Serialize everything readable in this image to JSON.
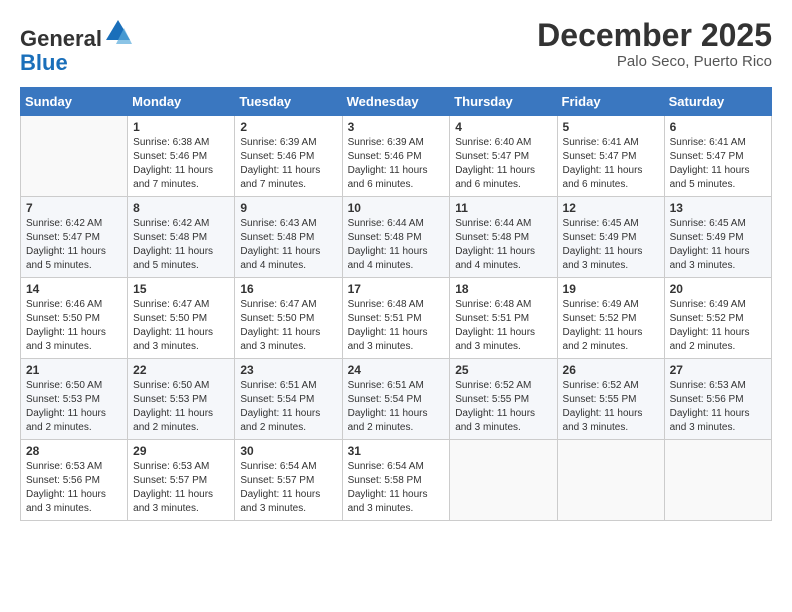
{
  "logo": {
    "general": "General",
    "blue": "Blue"
  },
  "title": "December 2025",
  "location": "Palo Seco, Puerto Rico",
  "days_of_week": [
    "Sunday",
    "Monday",
    "Tuesday",
    "Wednesday",
    "Thursday",
    "Friday",
    "Saturday"
  ],
  "weeks": [
    [
      {
        "day": "",
        "info": ""
      },
      {
        "day": "1",
        "info": "Sunrise: 6:38 AM\nSunset: 5:46 PM\nDaylight: 11 hours and 7 minutes."
      },
      {
        "day": "2",
        "info": "Sunrise: 6:39 AM\nSunset: 5:46 PM\nDaylight: 11 hours and 7 minutes."
      },
      {
        "day": "3",
        "info": "Sunrise: 6:39 AM\nSunset: 5:46 PM\nDaylight: 11 hours and 6 minutes."
      },
      {
        "day": "4",
        "info": "Sunrise: 6:40 AM\nSunset: 5:47 PM\nDaylight: 11 hours and 6 minutes."
      },
      {
        "day": "5",
        "info": "Sunrise: 6:41 AM\nSunset: 5:47 PM\nDaylight: 11 hours and 6 minutes."
      },
      {
        "day": "6",
        "info": "Sunrise: 6:41 AM\nSunset: 5:47 PM\nDaylight: 11 hours and 5 minutes."
      }
    ],
    [
      {
        "day": "7",
        "info": "Sunrise: 6:42 AM\nSunset: 5:47 PM\nDaylight: 11 hours and 5 minutes."
      },
      {
        "day": "8",
        "info": "Sunrise: 6:42 AM\nSunset: 5:48 PM\nDaylight: 11 hours and 5 minutes."
      },
      {
        "day": "9",
        "info": "Sunrise: 6:43 AM\nSunset: 5:48 PM\nDaylight: 11 hours and 4 minutes."
      },
      {
        "day": "10",
        "info": "Sunrise: 6:44 AM\nSunset: 5:48 PM\nDaylight: 11 hours and 4 minutes."
      },
      {
        "day": "11",
        "info": "Sunrise: 6:44 AM\nSunset: 5:48 PM\nDaylight: 11 hours and 4 minutes."
      },
      {
        "day": "12",
        "info": "Sunrise: 6:45 AM\nSunset: 5:49 PM\nDaylight: 11 hours and 3 minutes."
      },
      {
        "day": "13",
        "info": "Sunrise: 6:45 AM\nSunset: 5:49 PM\nDaylight: 11 hours and 3 minutes."
      }
    ],
    [
      {
        "day": "14",
        "info": "Sunrise: 6:46 AM\nSunset: 5:50 PM\nDaylight: 11 hours and 3 minutes."
      },
      {
        "day": "15",
        "info": "Sunrise: 6:47 AM\nSunset: 5:50 PM\nDaylight: 11 hours and 3 minutes."
      },
      {
        "day": "16",
        "info": "Sunrise: 6:47 AM\nSunset: 5:50 PM\nDaylight: 11 hours and 3 minutes."
      },
      {
        "day": "17",
        "info": "Sunrise: 6:48 AM\nSunset: 5:51 PM\nDaylight: 11 hours and 3 minutes."
      },
      {
        "day": "18",
        "info": "Sunrise: 6:48 AM\nSunset: 5:51 PM\nDaylight: 11 hours and 3 minutes."
      },
      {
        "day": "19",
        "info": "Sunrise: 6:49 AM\nSunset: 5:52 PM\nDaylight: 11 hours and 2 minutes."
      },
      {
        "day": "20",
        "info": "Sunrise: 6:49 AM\nSunset: 5:52 PM\nDaylight: 11 hours and 2 minutes."
      }
    ],
    [
      {
        "day": "21",
        "info": "Sunrise: 6:50 AM\nSunset: 5:53 PM\nDaylight: 11 hours and 2 minutes."
      },
      {
        "day": "22",
        "info": "Sunrise: 6:50 AM\nSunset: 5:53 PM\nDaylight: 11 hours and 2 minutes."
      },
      {
        "day": "23",
        "info": "Sunrise: 6:51 AM\nSunset: 5:54 PM\nDaylight: 11 hours and 2 minutes."
      },
      {
        "day": "24",
        "info": "Sunrise: 6:51 AM\nSunset: 5:54 PM\nDaylight: 11 hours and 2 minutes."
      },
      {
        "day": "25",
        "info": "Sunrise: 6:52 AM\nSunset: 5:55 PM\nDaylight: 11 hours and 3 minutes."
      },
      {
        "day": "26",
        "info": "Sunrise: 6:52 AM\nSunset: 5:55 PM\nDaylight: 11 hours and 3 minutes."
      },
      {
        "day": "27",
        "info": "Sunrise: 6:53 AM\nSunset: 5:56 PM\nDaylight: 11 hours and 3 minutes."
      }
    ],
    [
      {
        "day": "28",
        "info": "Sunrise: 6:53 AM\nSunset: 5:56 PM\nDaylight: 11 hours and 3 minutes."
      },
      {
        "day": "29",
        "info": "Sunrise: 6:53 AM\nSunset: 5:57 PM\nDaylight: 11 hours and 3 minutes."
      },
      {
        "day": "30",
        "info": "Sunrise: 6:54 AM\nSunset: 5:57 PM\nDaylight: 11 hours and 3 minutes."
      },
      {
        "day": "31",
        "info": "Sunrise: 6:54 AM\nSunset: 5:58 PM\nDaylight: 11 hours and 3 minutes."
      },
      {
        "day": "",
        "info": ""
      },
      {
        "day": "",
        "info": ""
      },
      {
        "day": "",
        "info": ""
      }
    ]
  ]
}
